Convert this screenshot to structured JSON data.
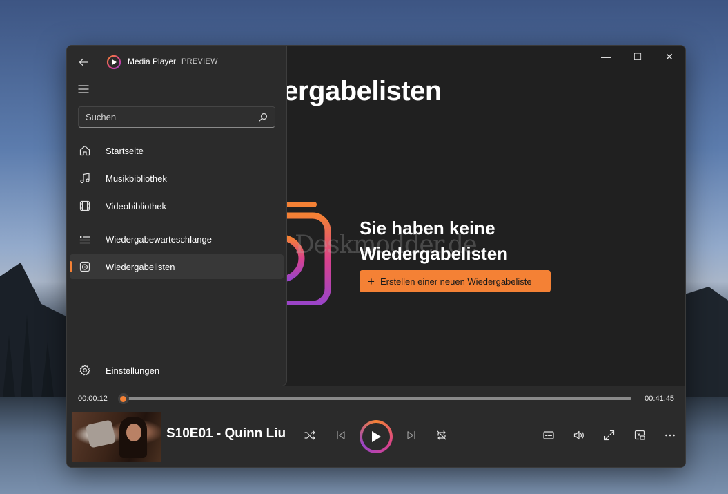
{
  "window": {
    "page_title": "Wiedergabelisten",
    "caption": {
      "minimize": "—",
      "maximize": "☐",
      "close": "✕"
    }
  },
  "nav": {
    "app_name": "Media Player",
    "app_badge": "PREVIEW",
    "search": {
      "placeholder": "Suchen"
    },
    "items": [
      {
        "label": "Startseite",
        "icon": "home-icon"
      },
      {
        "label": "Musikbibliothek",
        "icon": "music-note-icon"
      },
      {
        "label": "Videobibliothek",
        "icon": "film-icon"
      },
      {
        "label": "Wiedergabewarteschlange",
        "icon": "queue-icon"
      },
      {
        "label": "Wiedergabelisten",
        "icon": "playlist-icon",
        "active": true
      }
    ],
    "settings": {
      "label": "Einstellungen",
      "icon": "gear-icon"
    }
  },
  "empty_state": {
    "title": "Sie haben keine Wiedergabelisten",
    "create_button": "Erstellen einer neuen Wiedergabeliste"
  },
  "watermark": "Deskmodder.de",
  "player": {
    "elapsed": "00:00:12",
    "duration": "00:41:45",
    "progress": 0.005,
    "now_playing": "S10E01 - Quinn Liu"
  },
  "colors": {
    "accent": "#f48135",
    "window_bg": "#202020",
    "nav_bg": "#2b2b2b"
  }
}
